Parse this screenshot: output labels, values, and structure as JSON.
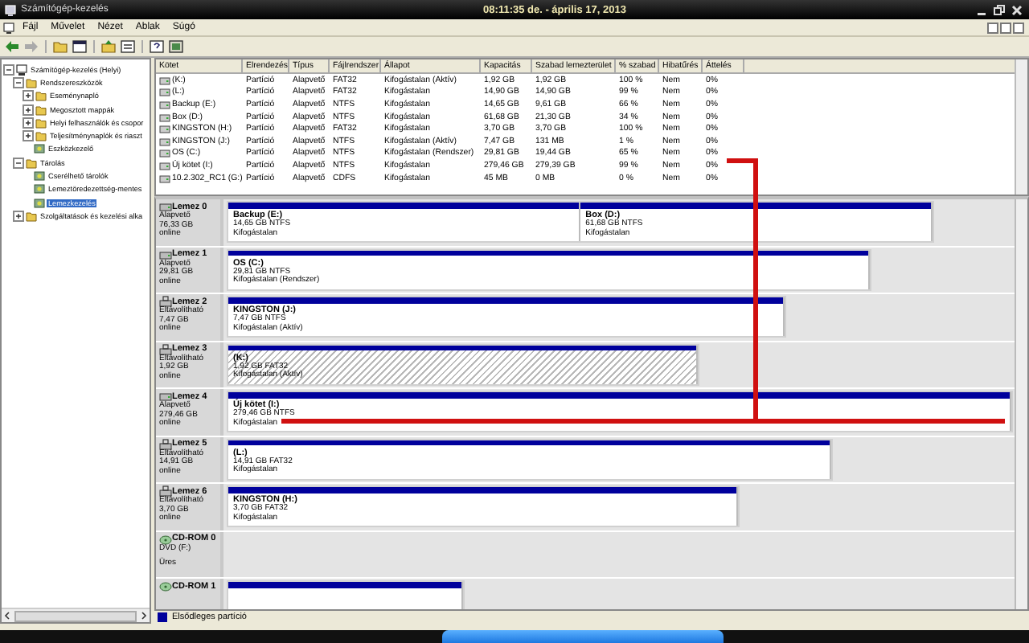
{
  "window": {
    "title": "Számítógép-kezelés",
    "clock": "08:11:35 de. - április 17, 2013"
  },
  "menu": [
    "Fájl",
    "Művelet",
    "Nézet",
    "Ablak",
    "Súgó"
  ],
  "tree": [
    {
      "label": "Számítógép-kezelés (Helyi)",
      "kind": "root",
      "expanded": true,
      "selected": false,
      "children": [
        {
          "label": "Rendszereszközök",
          "kind": "folder",
          "expanded": true,
          "selected": false,
          "children": [
            {
              "label": "Eseménynapló",
              "kind": "folder",
              "expanded": false,
              "selected": false
            },
            {
              "label": "Megosztott mappák",
              "kind": "folder",
              "expanded": false,
              "selected": false
            },
            {
              "label": "Helyi felhasználók és csopor",
              "kind": "folder",
              "expanded": false,
              "selected": false
            },
            {
              "label": "Teljesítménynaplók és riaszt",
              "kind": "folder",
              "expanded": false,
              "selected": false
            },
            {
              "label": "Eszközkezelő",
              "kind": "leaf",
              "selected": false
            }
          ]
        },
        {
          "label": "Tárolás",
          "kind": "folder",
          "expanded": true,
          "selected": false,
          "children": [
            {
              "label": "Cserélhető tárolók",
              "kind": "leaf",
              "selected": false
            },
            {
              "label": "Lemeztöredezettség-mentes",
              "kind": "leaf",
              "selected": false
            },
            {
              "label": "Lemezkezelés",
              "kind": "leaf",
              "selected": true
            }
          ]
        },
        {
          "label": "Szolgáltatások és kezelési alka",
          "kind": "folder",
          "expanded": false,
          "selected": false
        }
      ]
    }
  ],
  "volumes": {
    "columns": [
      "Kötet",
      "Elrendezés",
      "Típus",
      "Fájlrendszer",
      "Állapot",
      "Kapacitás",
      "Szabad lemezterület",
      "% szabad",
      "Hibatűrés",
      "Áttelés"
    ],
    "rows": [
      [
        "(K:)",
        "Partíció",
        "Alapvető",
        "FAT32",
        "Kifogástalan (Aktív)",
        "1,92 GB",
        "1,92 GB",
        "100 %",
        "Nem",
        "0%"
      ],
      [
        "(L:)",
        "Partíció",
        "Alapvető",
        "FAT32",
        "Kifogástalan",
        "14,90 GB",
        "14,90 GB",
        "99 %",
        "Nem",
        "0%"
      ],
      [
        "Backup (E:)",
        "Partíció",
        "Alapvető",
        "NTFS",
        "Kifogástalan",
        "14,65 GB",
        "9,61 GB",
        "66 %",
        "Nem",
        "0%"
      ],
      [
        "Box (D:)",
        "Partíció",
        "Alapvető",
        "NTFS",
        "Kifogástalan",
        "61,68 GB",
        "21,30 GB",
        "34 %",
        "Nem",
        "0%"
      ],
      [
        "KINGSTON (H:)",
        "Partíció",
        "Alapvető",
        "FAT32",
        "Kifogástalan",
        "3,70 GB",
        "3,70 GB",
        "100 %",
        "Nem",
        "0%"
      ],
      [
        "KINGSTON (J:)",
        "Partíció",
        "Alapvető",
        "NTFS",
        "Kifogástalan (Aktív)",
        "7,47 GB",
        "131 MB",
        "1 %",
        "Nem",
        "0%"
      ],
      [
        "OS (C:)",
        "Partíció",
        "Alapvető",
        "NTFS",
        "Kifogástalan (Rendszer)",
        "29,81 GB",
        "19,44 GB",
        "65 %",
        "Nem",
        "0%"
      ],
      [
        "Új kötet (I:)",
        "Partíció",
        "Alapvető",
        "NTFS",
        "Kifogástalan",
        "279,46 GB",
        "279,39 GB",
        "99 %",
        "Nem",
        "0%"
      ],
      [
        "10.2.302_RC1 (G:)",
        "Partíció",
        "Alapvető",
        "CDFS",
        "Kifogástalan",
        "45 MB",
        "0 MB",
        "0 %",
        "Nem",
        "0%"
      ]
    ]
  },
  "disks": [
    {
      "name": "Lemez 0",
      "kind": "disk",
      "type": "Alapvető",
      "size": "76,33 GB",
      "status": "online",
      "partitions": [
        {
          "name": "Backup (E:)",
          "detail": "14,65 GB NTFS",
          "state": "Kifogástalan",
          "hatched": false
        },
        {
          "name": "Box (D:)",
          "detail": "61,68 GB NTFS",
          "state": "Kifogástalan",
          "hatched": false
        }
      ]
    },
    {
      "name": "Lemez 1",
      "kind": "disk",
      "type": "Alapvető",
      "size": "29,81 GB",
      "status": "online",
      "partitions": [
        {
          "name": "OS (C:)",
          "detail": "29,81 GB NTFS",
          "state": "Kifogástalan (Rendszer)",
          "hatched": false
        }
      ]
    },
    {
      "name": "Lemez 2",
      "kind": "removable",
      "type": "Eltávolítható",
      "size": "7,47 GB",
      "status": "online",
      "partitions": [
        {
          "name": "KINGSTON (J:)",
          "detail": "7,47 GB NTFS",
          "state": "Kifogástalan (Aktív)",
          "hatched": false
        }
      ]
    },
    {
      "name": "Lemez 3",
      "kind": "removable",
      "type": "Eltávolítható",
      "size": "1,92 GB",
      "status": "online",
      "partitions": [
        {
          "name": "(K:)",
          "detail": "1,92 GB FAT32",
          "state": "Kifogástalan (Aktív)",
          "hatched": true
        }
      ]
    },
    {
      "name": "Lemez 4",
      "kind": "disk",
      "type": "Alapvető",
      "size": "279,46 GB",
      "status": "online",
      "partitions": [
        {
          "name": "Új kötet (I:)",
          "detail": "279,46 GB NTFS",
          "state": "Kifogástalan",
          "hatched": false
        }
      ]
    },
    {
      "name": "Lemez 5",
      "kind": "removable",
      "type": "Eltávolítható",
      "size": "14,91 GB",
      "status": "online",
      "partitions": [
        {
          "name": "(L:)",
          "detail": "14,91 GB FAT32",
          "state": "Kifogástalan",
          "hatched": false
        }
      ]
    },
    {
      "name": "Lemez 6",
      "kind": "removable",
      "type": "Eltávolítható",
      "size": "3,70 GB",
      "status": "online",
      "partitions": [
        {
          "name": "KINGSTON (H:)",
          "detail": "3,70 GB FAT32",
          "state": "Kifogástalan",
          "hatched": false
        }
      ]
    },
    {
      "name": "CD-ROM 0",
      "kind": "cdrom",
      "type": "DVD (F:)",
      "status": "Üres"
    },
    {
      "name": "CD-ROM 1",
      "kind": "cdrom",
      "partitions": [
        {
          "hatched": false
        }
      ]
    }
  ],
  "legend": [
    {
      "label": "Elsődleges partíció",
      "color": "#00009c"
    }
  ]
}
